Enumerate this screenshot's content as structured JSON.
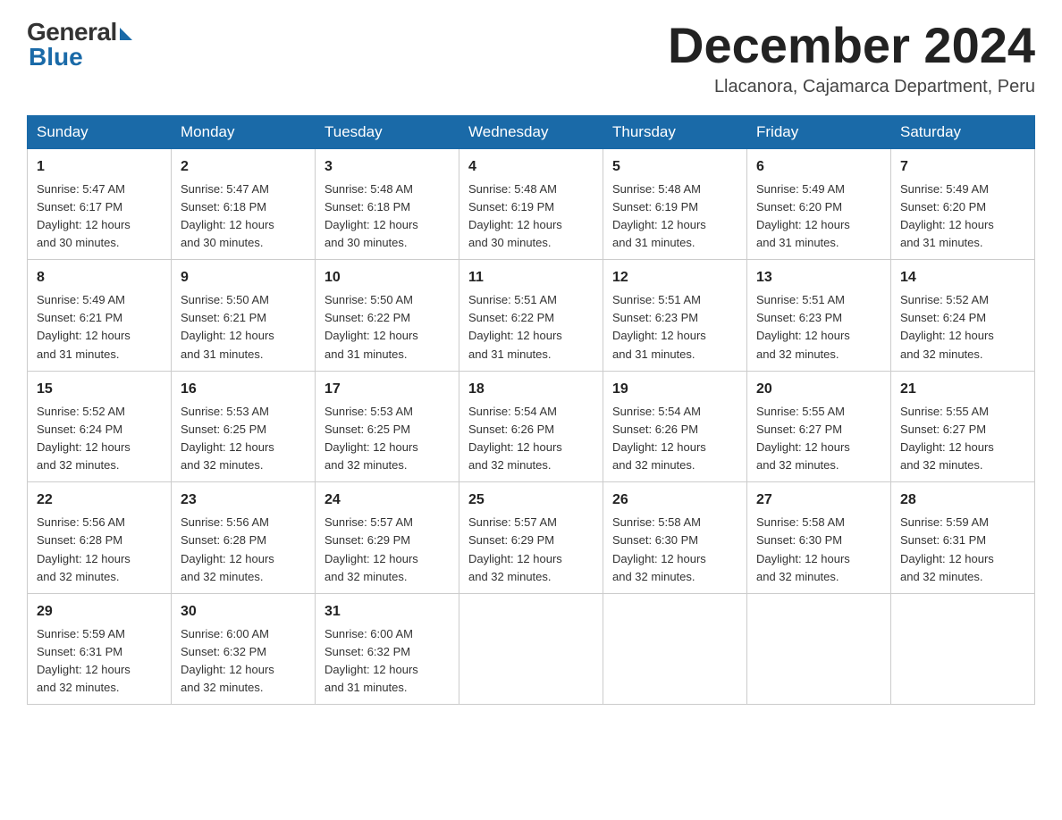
{
  "logo": {
    "general": "General",
    "blue": "Blue"
  },
  "title": "December 2024",
  "location": "Llacanora, Cajamarca Department, Peru",
  "days_header": [
    "Sunday",
    "Monday",
    "Tuesday",
    "Wednesday",
    "Thursday",
    "Friday",
    "Saturday"
  ],
  "weeks": [
    [
      {
        "num": "1",
        "info": "Sunrise: 5:47 AM\nSunset: 6:17 PM\nDaylight: 12 hours\nand 30 minutes."
      },
      {
        "num": "2",
        "info": "Sunrise: 5:47 AM\nSunset: 6:18 PM\nDaylight: 12 hours\nand 30 minutes."
      },
      {
        "num": "3",
        "info": "Sunrise: 5:48 AM\nSunset: 6:18 PM\nDaylight: 12 hours\nand 30 minutes."
      },
      {
        "num": "4",
        "info": "Sunrise: 5:48 AM\nSunset: 6:19 PM\nDaylight: 12 hours\nand 30 minutes."
      },
      {
        "num": "5",
        "info": "Sunrise: 5:48 AM\nSunset: 6:19 PM\nDaylight: 12 hours\nand 31 minutes."
      },
      {
        "num": "6",
        "info": "Sunrise: 5:49 AM\nSunset: 6:20 PM\nDaylight: 12 hours\nand 31 minutes."
      },
      {
        "num": "7",
        "info": "Sunrise: 5:49 AM\nSunset: 6:20 PM\nDaylight: 12 hours\nand 31 minutes."
      }
    ],
    [
      {
        "num": "8",
        "info": "Sunrise: 5:49 AM\nSunset: 6:21 PM\nDaylight: 12 hours\nand 31 minutes."
      },
      {
        "num": "9",
        "info": "Sunrise: 5:50 AM\nSunset: 6:21 PM\nDaylight: 12 hours\nand 31 minutes."
      },
      {
        "num": "10",
        "info": "Sunrise: 5:50 AM\nSunset: 6:22 PM\nDaylight: 12 hours\nand 31 minutes."
      },
      {
        "num": "11",
        "info": "Sunrise: 5:51 AM\nSunset: 6:22 PM\nDaylight: 12 hours\nand 31 minutes."
      },
      {
        "num": "12",
        "info": "Sunrise: 5:51 AM\nSunset: 6:23 PM\nDaylight: 12 hours\nand 31 minutes."
      },
      {
        "num": "13",
        "info": "Sunrise: 5:51 AM\nSunset: 6:23 PM\nDaylight: 12 hours\nand 32 minutes."
      },
      {
        "num": "14",
        "info": "Sunrise: 5:52 AM\nSunset: 6:24 PM\nDaylight: 12 hours\nand 32 minutes."
      }
    ],
    [
      {
        "num": "15",
        "info": "Sunrise: 5:52 AM\nSunset: 6:24 PM\nDaylight: 12 hours\nand 32 minutes."
      },
      {
        "num": "16",
        "info": "Sunrise: 5:53 AM\nSunset: 6:25 PM\nDaylight: 12 hours\nand 32 minutes."
      },
      {
        "num": "17",
        "info": "Sunrise: 5:53 AM\nSunset: 6:25 PM\nDaylight: 12 hours\nand 32 minutes."
      },
      {
        "num": "18",
        "info": "Sunrise: 5:54 AM\nSunset: 6:26 PM\nDaylight: 12 hours\nand 32 minutes."
      },
      {
        "num": "19",
        "info": "Sunrise: 5:54 AM\nSunset: 6:26 PM\nDaylight: 12 hours\nand 32 minutes."
      },
      {
        "num": "20",
        "info": "Sunrise: 5:55 AM\nSunset: 6:27 PM\nDaylight: 12 hours\nand 32 minutes."
      },
      {
        "num": "21",
        "info": "Sunrise: 5:55 AM\nSunset: 6:27 PM\nDaylight: 12 hours\nand 32 minutes."
      }
    ],
    [
      {
        "num": "22",
        "info": "Sunrise: 5:56 AM\nSunset: 6:28 PM\nDaylight: 12 hours\nand 32 minutes."
      },
      {
        "num": "23",
        "info": "Sunrise: 5:56 AM\nSunset: 6:28 PM\nDaylight: 12 hours\nand 32 minutes."
      },
      {
        "num": "24",
        "info": "Sunrise: 5:57 AM\nSunset: 6:29 PM\nDaylight: 12 hours\nand 32 minutes."
      },
      {
        "num": "25",
        "info": "Sunrise: 5:57 AM\nSunset: 6:29 PM\nDaylight: 12 hours\nand 32 minutes."
      },
      {
        "num": "26",
        "info": "Sunrise: 5:58 AM\nSunset: 6:30 PM\nDaylight: 12 hours\nand 32 minutes."
      },
      {
        "num": "27",
        "info": "Sunrise: 5:58 AM\nSunset: 6:30 PM\nDaylight: 12 hours\nand 32 minutes."
      },
      {
        "num": "28",
        "info": "Sunrise: 5:59 AM\nSunset: 6:31 PM\nDaylight: 12 hours\nand 32 minutes."
      }
    ],
    [
      {
        "num": "29",
        "info": "Sunrise: 5:59 AM\nSunset: 6:31 PM\nDaylight: 12 hours\nand 32 minutes."
      },
      {
        "num": "30",
        "info": "Sunrise: 6:00 AM\nSunset: 6:32 PM\nDaylight: 12 hours\nand 32 minutes."
      },
      {
        "num": "31",
        "info": "Sunrise: 6:00 AM\nSunset: 6:32 PM\nDaylight: 12 hours\nand 31 minutes."
      },
      null,
      null,
      null,
      null
    ]
  ]
}
